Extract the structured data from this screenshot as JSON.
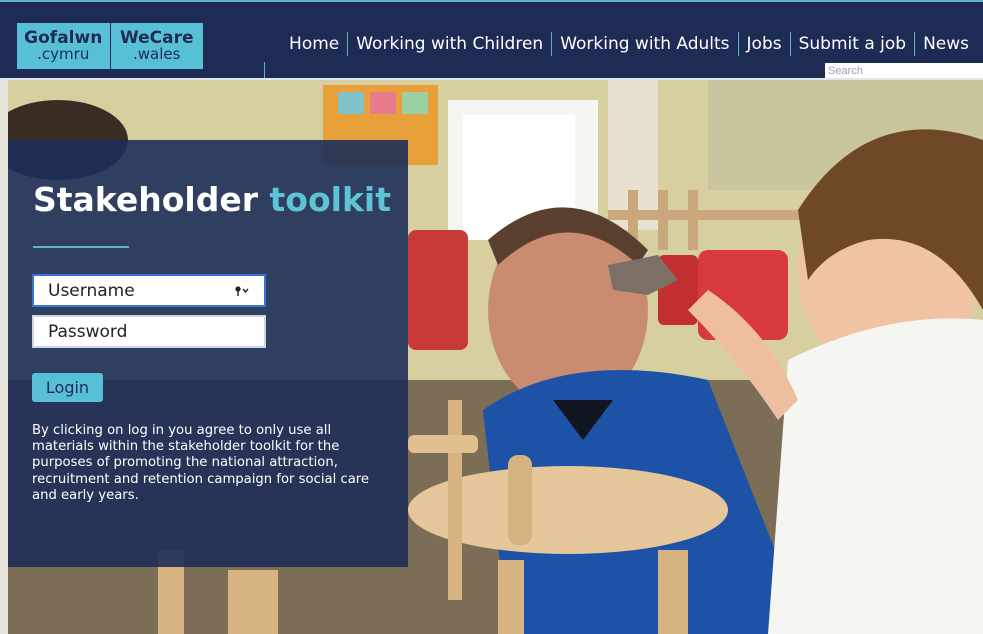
{
  "logo": {
    "left_main": "Gofalwn",
    "left_sub": ".cymru",
    "right_main": "WeCare",
    "right_sub": ".wales"
  },
  "nav": {
    "items": [
      "Home",
      "Working with Children",
      "Working with Adults",
      "Jobs",
      "Submit a job",
      "News"
    ]
  },
  "search": {
    "placeholder": "Search"
  },
  "login": {
    "title_main": "Stakeholder",
    "title_accent": "toolkit",
    "username_placeholder": "Username",
    "password_placeholder": "Password",
    "login_label": "Login",
    "disclaimer": "By clicking on log in you agree to only use all materials within the stakeholder toolkit for the purposes of promoting the national attraction, recruitment and retention campaign for social care and early years."
  },
  "colors": {
    "navy": "#1e2b54",
    "accent": "#58c0d6",
    "field_focus": "#3a74d1"
  },
  "icons": [
    "key-icon"
  ]
}
